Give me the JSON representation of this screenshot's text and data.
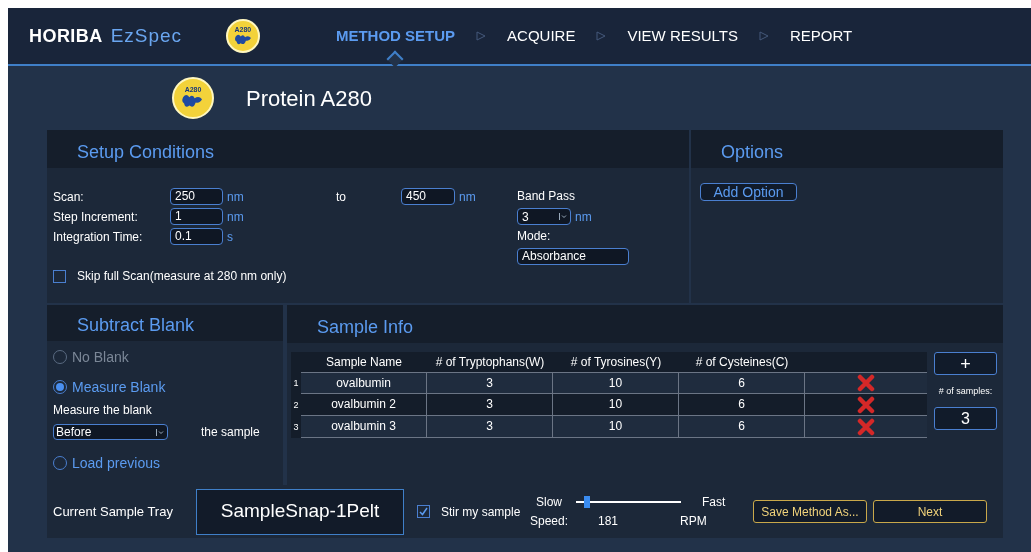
{
  "header": {
    "brand": "HORIBA",
    "product": "EzSpec",
    "icon_text": "A280",
    "tabs": [
      {
        "label": "METHOD SETUP",
        "selected": true
      },
      {
        "label": "ACQUIRE",
        "selected": false
      },
      {
        "label": "VIEW RESULTS",
        "selected": false
      },
      {
        "label": "REPORT",
        "selected": false
      }
    ]
  },
  "method": {
    "icon_text": "A280",
    "title": "Protein A280"
  },
  "setup": {
    "title": "Setup Conditions",
    "scan": {
      "label": "Scan:",
      "from": "250",
      "from_unit": "nm",
      "to_label": "to",
      "to": "450",
      "to_unit": "nm"
    },
    "step": {
      "label": "Step Increment:",
      "value": "1",
      "unit": "nm"
    },
    "integration": {
      "label": "Integration Time:",
      "value": "0.1",
      "unit": "s"
    },
    "skip": {
      "label": "Skip full Scan(measure at 280 nm only)",
      "checked": false
    },
    "band_pass": {
      "label": "Band Pass",
      "value": "3",
      "unit": "nm"
    },
    "mode": {
      "label": "Mode:",
      "value": "Absorbance"
    }
  },
  "options": {
    "title": "Options",
    "button": "Add Option"
  },
  "blank": {
    "title": "Subtract Blank",
    "options": [
      {
        "label": "No Blank",
        "selected": false,
        "disabled": true
      },
      {
        "label": "Measure Blank",
        "selected": true,
        "disabled": false,
        "detail": {
          "label": "Measure the blank",
          "value": "Before",
          "suffix": "the sample"
        }
      },
      {
        "label": "Load previous",
        "selected": false,
        "disabled": false
      }
    ]
  },
  "samples": {
    "title": "Sample Info",
    "columns": [
      "Sample Name",
      "# of Tryptophans(W)",
      "# of Tyrosines(Y)",
      "# of Cysteines(C)"
    ],
    "rows": [
      {
        "index": "1",
        "cells": [
          "ovalbumin",
          "3",
          "10",
          "6"
        ]
      },
      {
        "index": "2",
        "cells": [
          "ovalbumin 2",
          "3",
          "10",
          "6"
        ]
      },
      {
        "index": "3",
        "cells": [
          "ovalbumin 3",
          "3",
          "10",
          "6"
        ]
      }
    ],
    "add_button": "+",
    "count_label": "# of samples:",
    "count": "3"
  },
  "bottom": {
    "tray_label": "Current Sample Tray",
    "tray": "SampleSnap-1Pelt",
    "stir": {
      "label": "Stir my sample",
      "checked": true
    },
    "speed": {
      "slow": "Slow",
      "fast": "Fast",
      "label": "Speed:",
      "value": "181",
      "unit": "RPM",
      "level": 0.08
    },
    "buttons": [
      "Save Method As...",
      "Next"
    ]
  }
}
